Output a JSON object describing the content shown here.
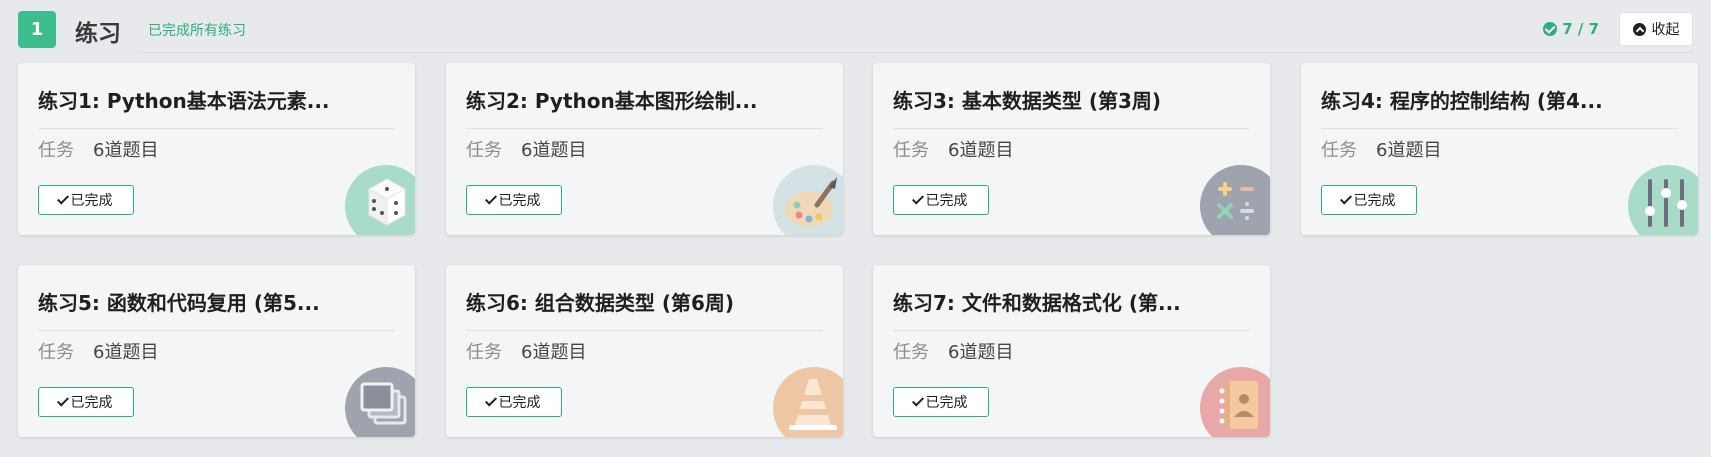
{
  "section": {
    "index": "1",
    "title": "练习",
    "status": "已完成所有练习",
    "progress": "7 / 7",
    "collapse_label": "收起"
  },
  "cards": [
    {
      "title": "练习1: Python基本语法元素...",
      "task_label": "任务",
      "task_count": "6道题目",
      "badge": "已完成",
      "icon": "dice-icon",
      "icon_color": "#a8dcc8"
    },
    {
      "title": "练习2: Python基本图形绘制...",
      "task_label": "任务",
      "task_count": "6道题目",
      "badge": "已完成",
      "icon": "palette-icon",
      "icon_color": "#d3e2e4"
    },
    {
      "title": "练习3: 基本数据类型 (第3周)",
      "task_label": "任务",
      "task_count": "6道题目",
      "badge": "已完成",
      "icon": "calculator-icon",
      "icon_color": "#9ea3ad"
    },
    {
      "title": "练习4: 程序的控制结构 (第4...",
      "task_label": "任务",
      "task_count": "6道题目",
      "badge": "已完成",
      "icon": "sliders-icon",
      "icon_color": "#a8dcc8"
    },
    {
      "title": "练习5: 函数和代码复用 (第5...",
      "task_label": "任务",
      "task_count": "6道题目",
      "badge": "已完成",
      "icon": "stacked-windows-icon",
      "icon_color": "#9ea3ad"
    },
    {
      "title": "练习6: 组合数据类型 (第6周)",
      "task_label": "任务",
      "task_count": "6道题目",
      "badge": "已完成",
      "icon": "cone-icon",
      "icon_color": "#f0c7a4"
    },
    {
      "title": "练习7: 文件和数据格式化 (第...",
      "task_label": "任务",
      "task_count": "6道题目",
      "badge": "已完成",
      "icon": "contact-book-icon",
      "icon_color": "#e8a8a8"
    }
  ],
  "colors": {
    "accent": "#2bb07d",
    "badge_bg": "#3dbd8e",
    "page_bg": "#e8e9ec",
    "card_bg": "#f4f5f6"
  }
}
